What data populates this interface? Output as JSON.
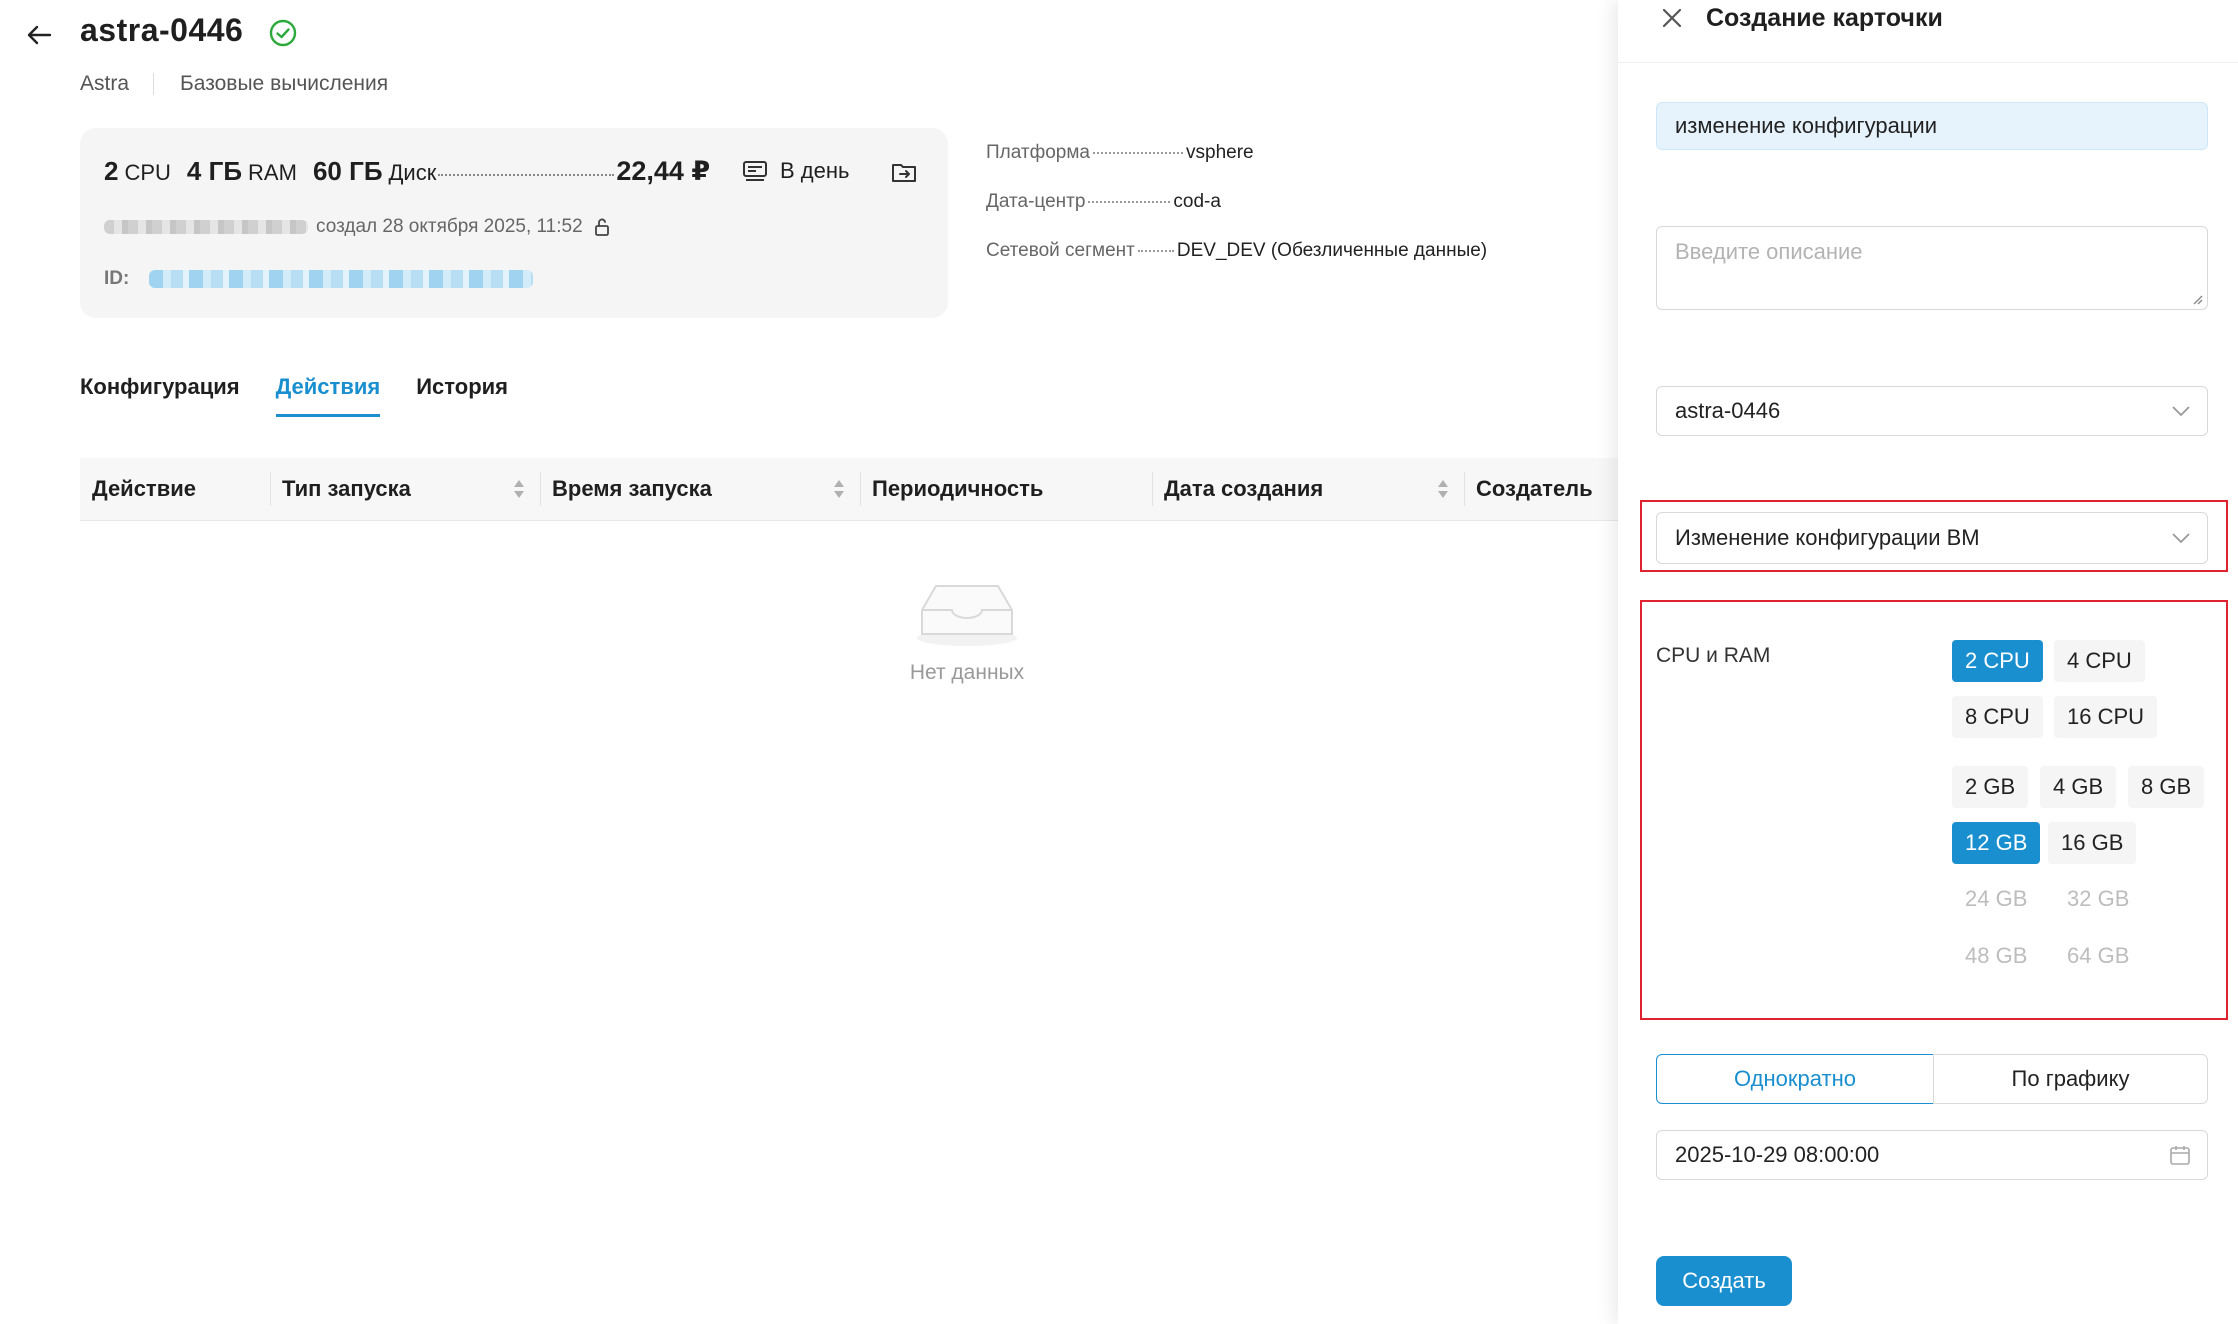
{
  "header": {
    "title": "astra-0446",
    "breadcrumbs": [
      "Astra",
      "Базовые вычисления"
    ]
  },
  "vm_card": {
    "cpu_value": "2",
    "cpu_unit": "CPU",
    "ram_value": "4 ГБ",
    "ram_unit": "RAM",
    "disk_value": "60 ГБ",
    "disk_unit": "Диск",
    "price": "22,44 ₽",
    "period": "В день",
    "created_text": "создал 28 октября 2025, 11:52",
    "id_label": "ID:"
  },
  "properties": [
    {
      "key": "Платформа",
      "value": "vsphere"
    },
    {
      "key": "Дата-центр",
      "value": "cod-a"
    },
    {
      "key": "Сетевой сегмент",
      "value": "DEV_DEV (Обезличенные данные)"
    }
  ],
  "tabs": [
    "Конфигурация",
    "Действия",
    "История"
  ],
  "active_tab": "Действия",
  "table": {
    "columns": [
      "Действие",
      "Тип запуска",
      "Время запуска",
      "Периодичность",
      "Дата создания",
      "Создатель"
    ],
    "empty_text": "Нет данных"
  },
  "drawer": {
    "title": "Создание карточки",
    "name_value": "изменение конфигурации",
    "description_placeholder": "Введите описание",
    "vm_select_value": "astra-0446",
    "action_select_value": "Изменение конфигурации ВМ",
    "cpu_ram_label": "CPU и RAM",
    "cpu_options": [
      {
        "label": "2 CPU",
        "state": "selected"
      },
      {
        "label": "4 CPU",
        "state": "normal"
      },
      {
        "label": "8 CPU",
        "state": "normal"
      },
      {
        "label": "16 CPU",
        "state": "normal"
      }
    ],
    "ram_options": [
      {
        "label": "2 GB",
        "state": "normal"
      },
      {
        "label": "4 GB",
        "state": "normal"
      },
      {
        "label": "8 GB",
        "state": "normal"
      },
      {
        "label": "12 GB",
        "state": "selected"
      },
      {
        "label": "16 GB",
        "state": "normal"
      },
      {
        "label": "24 GB",
        "state": "disabled"
      },
      {
        "label": "32 GB",
        "state": "disabled"
      },
      {
        "label": "48 GB",
        "state": "disabled"
      },
      {
        "label": "64 GB",
        "state": "disabled"
      }
    ],
    "schedule_once": "Однократно",
    "schedule_periodic": "По графику",
    "schedule_selected": "Однократно",
    "datetime_value": "2025-10-29 08:00:00",
    "create_button": "Создать"
  },
  "colors": {
    "accent": "#1a8fd0",
    "highlight_border": "#e0242f",
    "success": "#2eaa3c"
  }
}
